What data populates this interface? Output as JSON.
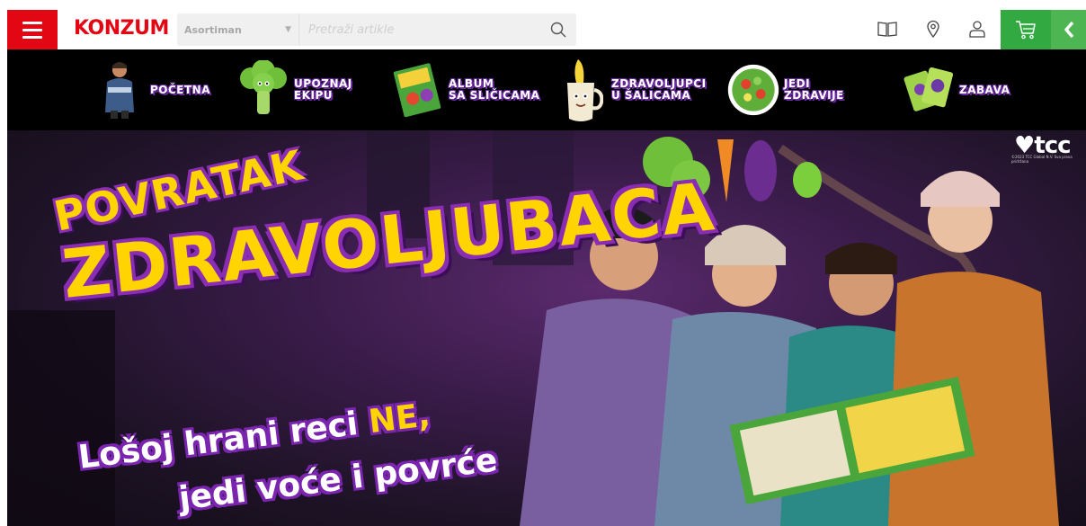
{
  "header": {
    "logo_text": "KONZUM",
    "category_select": "Asortiman",
    "search_placeholder": "Pretraži artikle",
    "colors": {
      "brand_red": "#e30613",
      "cart_green": "#32a941",
      "side_green": "#4db653"
    },
    "icons": [
      "hamburger-icon",
      "search-icon",
      "catalog-book-icon",
      "location-pin-icon",
      "user-icon",
      "cart-icon",
      "chevron-left-icon"
    ]
  },
  "nav": {
    "items": [
      {
        "label": "POČETNA",
        "icon": "boy-figure-thumbnail"
      },
      {
        "label": "UPOZNAJ\nEKIPU",
        "icon": "broccoli-character-thumbnail"
      },
      {
        "label": "ALBUM\nSA SLIČICAMA",
        "icon": "sticker-album-thumbnail"
      },
      {
        "label": "ZDRAVOLJUPCI\nU ŠALICAMA",
        "icon": "banana-mug-thumbnail"
      },
      {
        "label": "JEDI\nZDRAVIJE",
        "icon": "salad-bowl-thumbnail"
      },
      {
        "label": "ZABAVA",
        "icon": "game-cards-thumbnail"
      }
    ]
  },
  "hero": {
    "title_line1": "POVRATAK",
    "title_line2": "ZDRAVOLJUBACA",
    "slogan_line1_prefix": "Lošoj hrani reci ",
    "slogan_line1_highlight": "NE,",
    "slogan_line2": "jedi voće i povrće",
    "partner_logo": "tcc",
    "partner_fineprint": "©2023 TCC Global N.V. Sva prava pridržana"
  }
}
